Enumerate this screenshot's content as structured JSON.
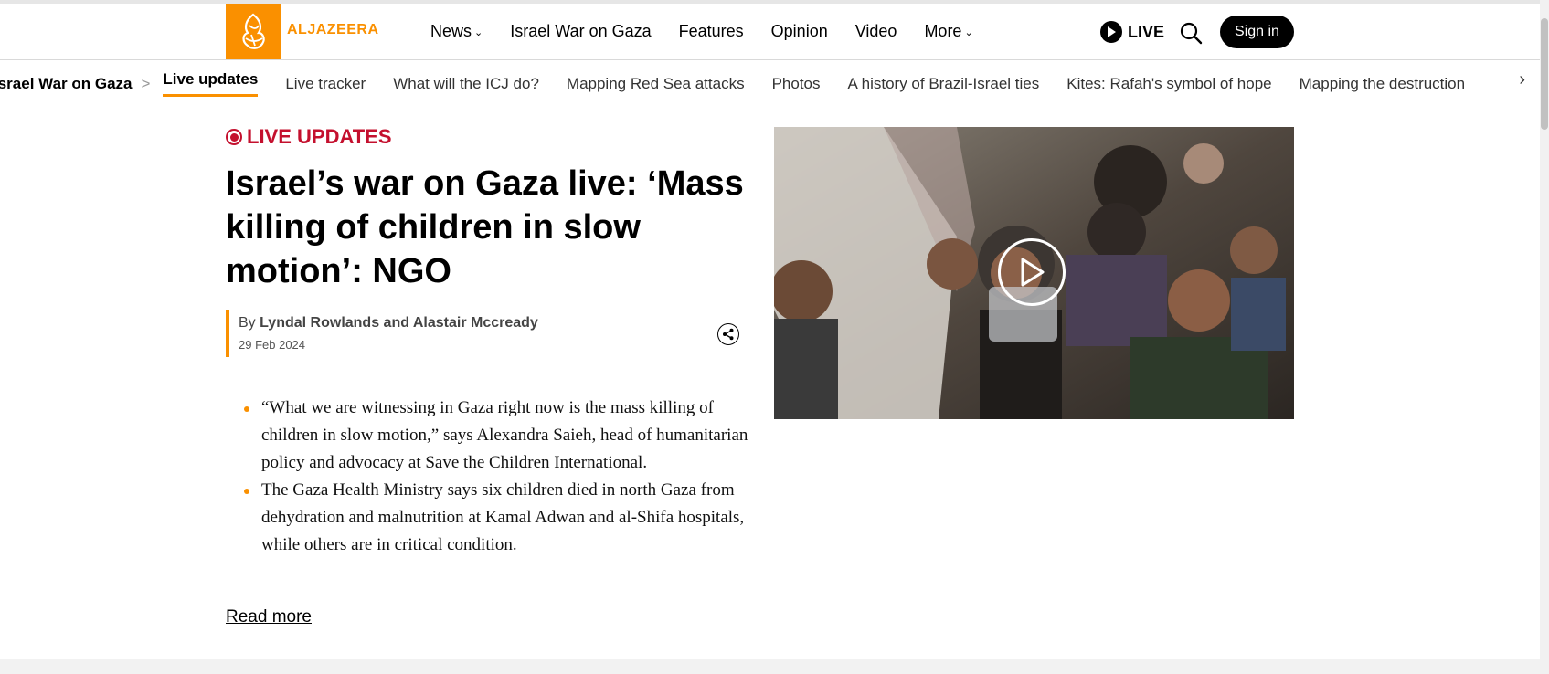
{
  "header": {
    "logo_text": "ALJAZEERA",
    "nav": [
      {
        "label": "News",
        "has_dropdown": true
      },
      {
        "label": "Israel War on Gaza",
        "has_dropdown": false
      },
      {
        "label": "Features",
        "has_dropdown": false
      },
      {
        "label": "Opinion",
        "has_dropdown": false
      },
      {
        "label": "Video",
        "has_dropdown": false
      },
      {
        "label": "More",
        "has_dropdown": true
      }
    ],
    "live_label": "LIVE",
    "signin_label": "Sign in"
  },
  "subnav": {
    "breadcrumb": "Israel War on Gaza",
    "breadcrumb_sep": ">",
    "items": [
      {
        "label": "Live updates",
        "active": true
      },
      {
        "label": "Live tracker",
        "active": false
      },
      {
        "label": "What will the ICJ do?",
        "active": false
      },
      {
        "label": "Mapping Red Sea attacks",
        "active": false
      },
      {
        "label": "Photos",
        "active": false
      },
      {
        "label": "A history of Brazil-Israel ties",
        "active": false
      },
      {
        "label": "Kites: Rafah's symbol of hope",
        "active": false
      },
      {
        "label": "Mapping the destruction",
        "active": false
      }
    ],
    "next_arrow": "›"
  },
  "article": {
    "live_label": "LIVE UPDATES",
    "headline": "Israel’s war on Gaza live: ‘Mass killing of children in slow motion’: NGO",
    "by_prefix": "By",
    "authors": "Lyndal Rowlands and Alastair Mccready",
    "date": "29 Feb 2024",
    "summary": [
      "“What we are witnessing in Gaza right now is the mass killing of children in slow motion,” says Alexandra Saieh, head of humanitarian policy and advocacy at Save the Children International.",
      "The Gaza Health Ministry says six children died in north Gaza from dehydration and malnutrition at Kamal Adwan and al-Shifa hospitals, while others are in critical condition."
    ],
    "read_more": "Read more"
  },
  "colors": {
    "brand_orange": "#fa9000",
    "live_red": "#c4102e",
    "text": "#000000"
  },
  "icons": [
    "aljazeera-logo-icon",
    "chevron-down-icon",
    "play-circle-icon",
    "search-icon",
    "live-dot-icon",
    "share-icon",
    "play-button-icon",
    "chevron-right-icon"
  ]
}
